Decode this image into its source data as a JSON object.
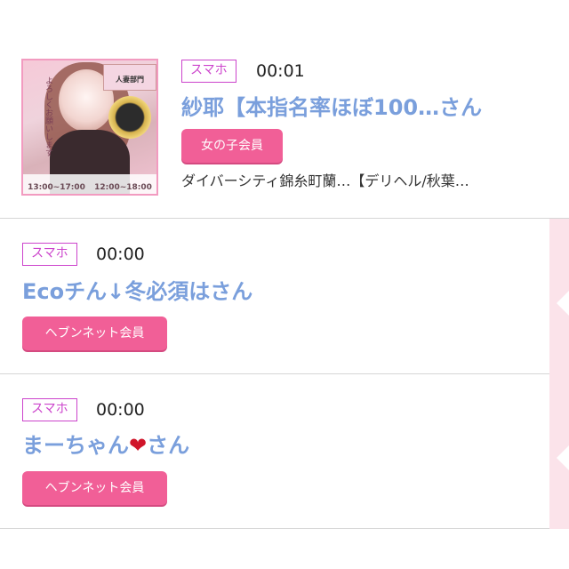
{
  "entries": [
    {
      "device_tag": "スマホ",
      "time": "00:01",
      "name": "紗耶【本指名率ほぼ100…さん",
      "member_type": "女の子会員",
      "shop": "ダイバーシティ錦糸町蘭…【デリヘル/秋葉…",
      "thumbnail": {
        "ribbon_text": "人妻部門",
        "side_text": "よろしくお願いします",
        "times": [
          "13:00~17:00",
          "12:00~18:00"
        ]
      }
    },
    {
      "device_tag": "スマホ",
      "time": "00:00",
      "name": "Ecoチん↓冬必須はさん",
      "member_type": "ヘブンネット会員"
    },
    {
      "device_tag": "スマホ",
      "time": "00:00",
      "name_prefix": "まーちゃん",
      "name_suffix": "さん",
      "heart_icon": "heart-icon",
      "member_type": "ヘブンネット会員"
    }
  ],
  "colors": {
    "name": "#7a9fdc",
    "device_tag": "#cc44cc",
    "member_badge": "#f15f97",
    "side_strip": "#fbe3ea"
  }
}
